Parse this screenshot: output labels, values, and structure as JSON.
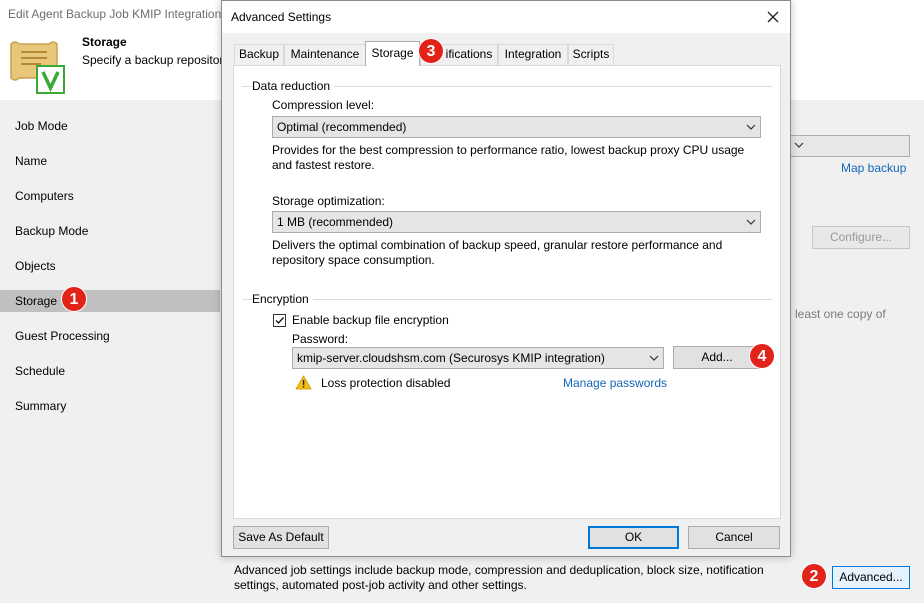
{
  "wizard": {
    "title": "Edit Agent Backup Job KMIP Integration",
    "header": {
      "title": "Storage",
      "subtitle": "Specify a backup repositor"
    },
    "nav_items": [
      "Job Mode",
      "Name",
      "Computers",
      "Backup Mode",
      "Objects",
      "Storage",
      "Guest Processing",
      "Schedule",
      "Summary"
    ],
    "active_nav": "Storage",
    "map_backup_link": "Map backup",
    "configure_button": "Configure...",
    "partial_text": "least one copy of",
    "footer_text": "Advanced job settings include backup mode, compression and deduplication, block size, notification settings, automated post-job activity and other settings.",
    "advanced_button": "Advanced..."
  },
  "dialog": {
    "title": "Advanced Settings",
    "close_icon": "close-icon",
    "tabs": [
      "Backup",
      "Maintenance",
      "Storage",
      "ifications",
      "Integration",
      "Scripts"
    ],
    "active_tab": "Storage",
    "data_reduction": {
      "group_label": "Data reduction",
      "compression_label": "Compression level:",
      "compression_value": "Optimal (recommended)",
      "compression_desc": "Provides for the best compression to performance ratio, lowest backup proxy CPU usage and fastest restore.",
      "storage_opt_label": "Storage optimization:",
      "storage_opt_value": "1 MB (recommended)",
      "storage_opt_desc": "Delivers the optimal combination of backup speed, granular restore performance and repository space consumption."
    },
    "encryption": {
      "group_label": "Encryption",
      "enable_label": "Enable backup file encryption",
      "enable_checked": true,
      "password_label": "Password:",
      "password_value": "kmip-server.cloudshsm.com (Securosys KMIP integration)",
      "add_button": "Add...",
      "warning_text": "Loss protection disabled",
      "manage_link": "Manage passwords"
    },
    "save_default_button": "Save As Default",
    "ok_button": "OK",
    "cancel_button": "Cancel"
  },
  "callouts": [
    "1",
    "2",
    "3",
    "4"
  ],
  "colors": {
    "callout": "#e2231a",
    "link": "#1566b7",
    "accent": "#0078d7",
    "logo_green": "#3aa935"
  }
}
